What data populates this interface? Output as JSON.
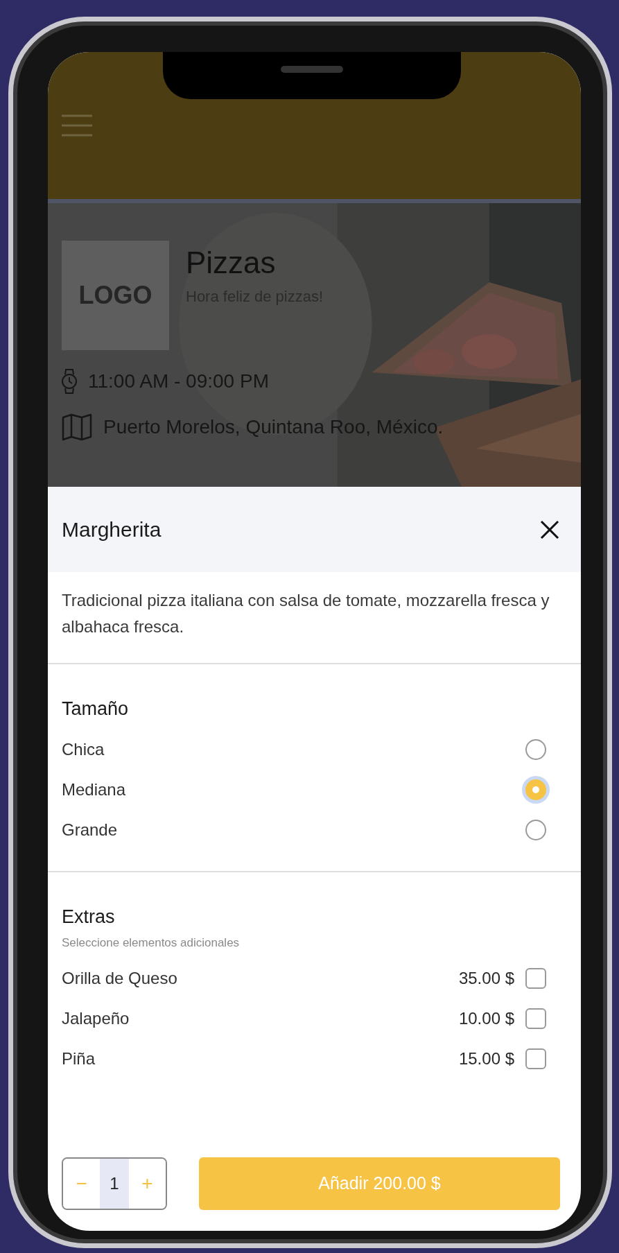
{
  "store": {
    "logo_text": "LOGO",
    "name": "Pizzas",
    "tagline": "Hora feliz de pizzas!",
    "hours": "11:00 AM - 09:00 PM",
    "address": "Puerto Morelos, Quintana Roo, México."
  },
  "modal": {
    "title": "Margherita",
    "description": "Tradicional pizza italiana con salsa de tomate, mozzarella fresca y albahaca fresca.",
    "sections": [
      {
        "title": "Tamaño",
        "kind": "radio",
        "options": [
          {
            "label": "Chica",
            "selected": false
          },
          {
            "label": "Mediana",
            "selected": true
          },
          {
            "label": "Grande",
            "selected": false
          }
        ]
      },
      {
        "title": "Extras",
        "kind": "checkbox",
        "subtitle": "Seleccione elementos adicionales",
        "options": [
          {
            "label": "Orilla de Queso",
            "price": "35.00 $",
            "checked": false
          },
          {
            "label": "Jalapeño",
            "price": "10.00 $",
            "checked": false
          },
          {
            "label": "Piña",
            "price": "15.00 $",
            "checked": false
          }
        ]
      }
    ],
    "quantity": {
      "minus": "−",
      "value": "1",
      "plus": "+"
    },
    "add_button": "Añadir 200.00 $"
  }
}
